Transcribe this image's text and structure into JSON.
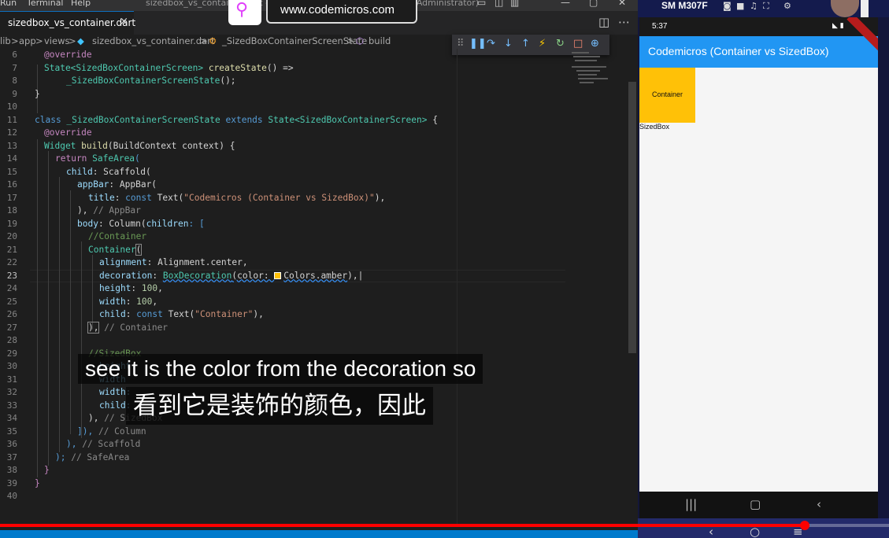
{
  "menubar": {
    "items": [
      "Run",
      "Terminal",
      "Help"
    ],
    "title": "sizedbox_vs_container.dart - flutter_task - Visual Studio Code (Administrator)"
  },
  "tab": {
    "label": "sizedbox_vs_container.dart",
    "close": "×"
  },
  "breadcrumb": {
    "items": [
      "lib",
      "app",
      "views",
      "sizedbox_vs_container.dart",
      "_SizedBoxContainerScreenState",
      "build"
    ],
    "separator": ">"
  },
  "line_numbers": [
    "6",
    "7",
    "8",
    "9",
    "10",
    "11",
    "12",
    "13",
    "14",
    "15",
    "16",
    "17",
    "18",
    "19",
    "20",
    "21",
    "22",
    "23",
    "24",
    "25",
    "26",
    "27",
    "28",
    "29",
    "30",
    "31",
    "32",
    "33",
    "34",
    "35",
    "36",
    "37",
    "38",
    "39",
    "40"
  ],
  "active_line": "23",
  "code": {
    "l6": "@override",
    "l7a": "State<SizedBoxContainerScreen>",
    "l7b": " createState",
    "l7c": "() =>",
    "l8a": "_SizedBoxContainerScreenState",
    "l8b": "();",
    "l9": "}",
    "l11a": "class",
    "l11b": " _SizedBoxContainerScreenState ",
    "l11c": "extends",
    "l11d": " State<SizedBoxContainerScreen>",
    "l11e": " {",
    "l12": "@override",
    "l13a": "Widget",
    "l13b": " build",
    "l13c": "(BuildContext context) {",
    "l14a": "return",
    "l14b": " SafeArea",
    "l14c": "(",
    "l15a": "child",
    "l15b": ": Scaffold(",
    "l16a": "appBar",
    "l16b": ": AppBar(",
    "l17a": "title",
    "l17b": ": ",
    "l17c": "const",
    "l17d": " Text(",
    "l17e": "\"Codemicros (Container vs SizedBox)\"",
    "l17f": "),",
    "l18a": "),",
    "l18b": " // AppBar",
    "l19a": "body",
    "l19b": ": Column(",
    "l19c": "children",
    "l19d": ": [",
    "l20": "//Container",
    "l21a": "Container",
    "l21b": "(",
    "l22a": "alignment",
    "l22b": ": Alignment.center,",
    "l23a": "decoration",
    "l23b": ": ",
    "l23c": "BoxDecoration",
    "l23d": "(color: ",
    "l23e": "Colors.amber",
    "l23f": "),",
    "l24a": "height",
    "l24b": ": ",
    "l24c": "100",
    "l24d": ",",
    "l25a": "width",
    "l25b": ": ",
    "l25c": "100",
    "l25d": ",",
    "l26a": "child",
    "l26b": ": ",
    "l26c": "const",
    "l26d": " Text(",
    "l26e": "\"Container\"",
    "l26f": "),",
    "l27a": "),",
    "l27b": " // Container",
    "l29": "//SizedBox",
    "l30": "height",
    "l31": "width",
    "l32": "width:",
    "l33": "child:",
    "l34a": "),",
    "l34b": " // SizedBox",
    "l35a": "]),",
    "l35b": " // Column",
    "l36a": "),",
    "l36b": " // Scaffold",
    "l37a": ");",
    "l37b": " // SafeArea",
    "l38": "}",
    "l39": "}"
  },
  "overlay": {
    "url": "www.codemicros.com",
    "subtitle_en": "see it is the color from the decoration so",
    "subtitle_zh": "看到它是装饰的颜色，因此"
  },
  "phone": {
    "device_name": "SM M307F",
    "time": "5:37",
    "app_title": "Codemicros (Container vs SizedBox)",
    "container_text": "Container",
    "sizedbox_text": "SizedBox",
    "container_color": "#ffc107",
    "appbar_color": "#2196f3"
  },
  "video": {
    "progress": 0.905
  },
  "colors": {
    "accent": "#007acc",
    "progress": "#ff0000",
    "background": "#1e1e1e"
  }
}
